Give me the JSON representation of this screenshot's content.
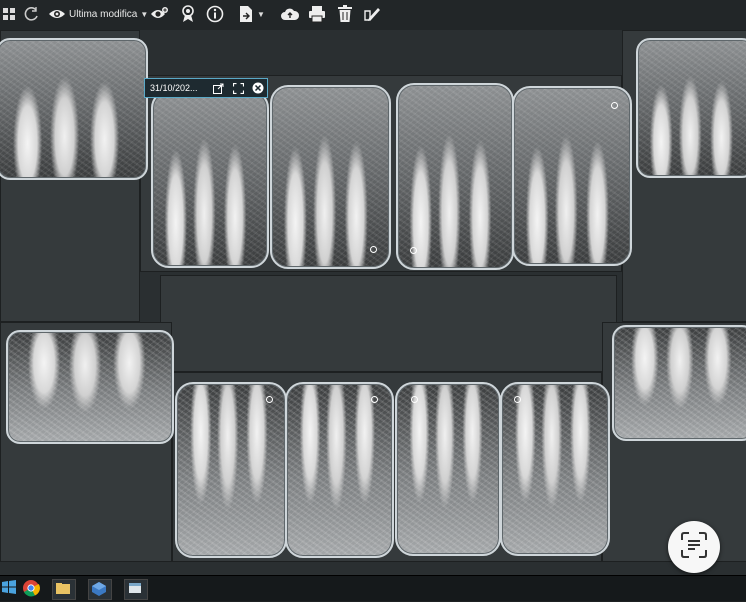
{
  "toolbar": {
    "sort_label": "Ultima modifica",
    "icons": [
      "back-icon",
      "eye-icon",
      "eye-add-icon",
      "award-icon",
      "info-icon",
      "export-icon",
      "cloud-upload-icon",
      "print-icon",
      "trash-icon",
      "edit-image-icon"
    ]
  },
  "selected_image": {
    "date": "31/10/202..."
  },
  "gallery": {
    "upper_count": 6,
    "lower_count": 6
  },
  "taskbar": {
    "icons": [
      "windows-start-icon",
      "chrome-icon",
      "file-explorer-icon",
      "virtualbox-icon",
      "app-icon"
    ]
  },
  "overlay": {
    "icon": "text-scan-icon"
  },
  "colors": {
    "selection": "#5aa9c7",
    "frame": "#cfd6da",
    "background": "#2a2f31"
  }
}
